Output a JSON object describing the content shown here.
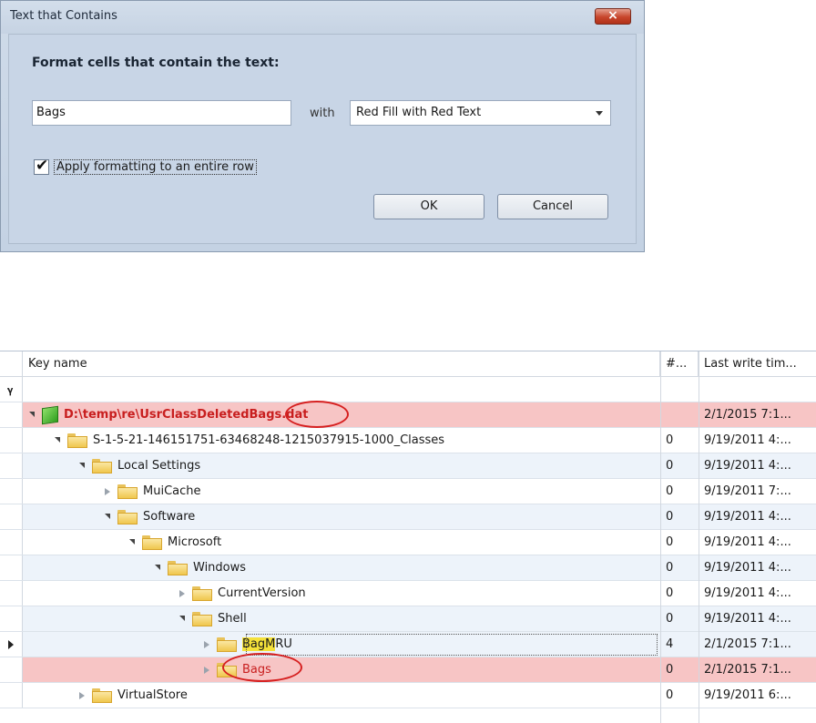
{
  "dialog": {
    "title": "Text that Contains",
    "close_label": "×",
    "heading": "Format cells that contain the text:",
    "text_value": "Bags",
    "with_label": "with",
    "format_selected": "Red Fill with Red Text",
    "apply_row_label": "Apply formatting to an entire row",
    "apply_row_checked": true,
    "check_glyph": "✔",
    "ok_label": "OK",
    "cancel_label": "Cancel"
  },
  "grid": {
    "columns": [
      "Key name",
      "#...",
      "Last write tim..."
    ],
    "filter_icon": "filter-icon",
    "rows": [
      {
        "label": "D:\\temp\\re\\UsrClassDeletedBags.dat",
        "count": "",
        "time": "2/1/2015 7:1..."
      },
      {
        "label": "S-1-5-21-146151751-63468248-1215037915-1000_Classes",
        "count": "0",
        "time": "9/19/2011 4:..."
      },
      {
        "label": "Local Settings",
        "count": "0",
        "time": "9/19/2011 4:..."
      },
      {
        "label": "MuiCache",
        "count": "0",
        "time": "9/19/2011 7:..."
      },
      {
        "label": "Software",
        "count": "0",
        "time": "9/19/2011 4:..."
      },
      {
        "label": "Microsoft",
        "count": "0",
        "time": "9/19/2011 4:..."
      },
      {
        "label": "Windows",
        "count": "0",
        "time": "9/19/2011 4:..."
      },
      {
        "label": "CurrentVersion",
        "count": "0",
        "time": "9/19/2011 4:..."
      },
      {
        "label": "Shell",
        "count": "0",
        "time": "9/19/2011 4:..."
      },
      {
        "label_match": "BagM",
        "label_rest": "RU",
        "count": "4",
        "time": "2/1/2015 7:1..."
      },
      {
        "label": "Bags",
        "count": "0",
        "time": "2/1/2015 7:1..."
      },
      {
        "label": "VirtualStore",
        "count": "0",
        "time": "9/19/2011 6:..."
      }
    ]
  },
  "colors": {
    "highlight_row": "#f7c5c5",
    "highlight_text": "#c81e1e",
    "match_highlight": "#f5e13a",
    "annotation_circle": "#d62020"
  }
}
